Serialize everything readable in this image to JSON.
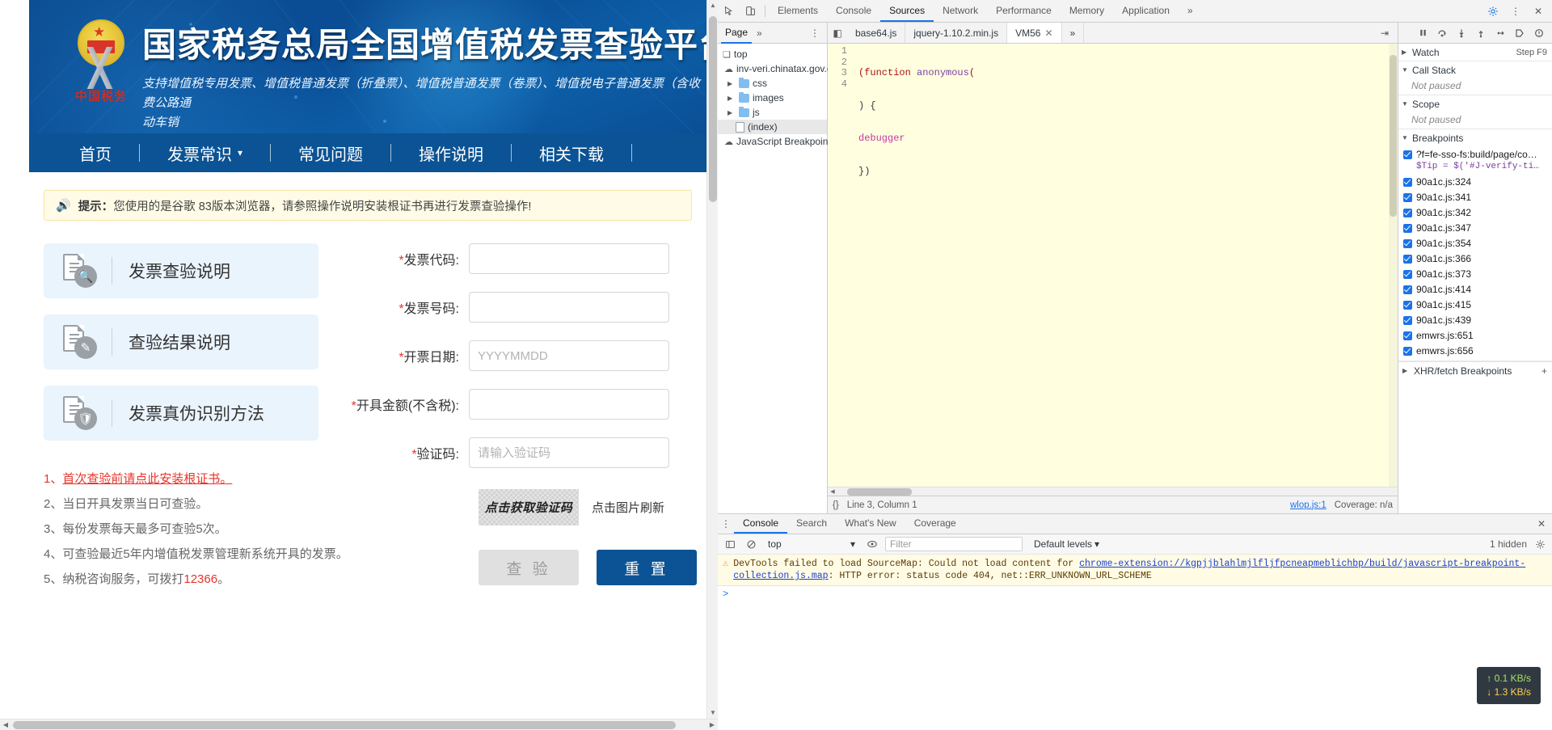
{
  "page": {
    "banner": {
      "title": "国家税务总局全国增值税发票查验平台",
      "subtitle": "支持增值税专用发票、增值税普通发票（折叠票）、增值税普通发票（卷票）、增值税电子普通发票（含收费公路通行费电子普通发票）、机动车销售统一发票、二手车销售统一发票的查验。",
      "subtitle_line1": "支持增值税专用发票、增值税普通发票（折叠票）、增值税普通发票（卷票）、增值税电子普通发票（含收费公路通",
      "subtitle_line2": "动车销",
      "emblem_text": "中国税务"
    },
    "nav": [
      {
        "label": "首页",
        "caret": false
      },
      {
        "label": "发票常识",
        "caret": true
      },
      {
        "label": "常见问题",
        "caret": false
      },
      {
        "label": "操作说明",
        "caret": false
      },
      {
        "label": "相关下载",
        "caret": false
      }
    ],
    "tip": {
      "icon": "speaker-icon",
      "prefix": "提示：",
      "text": "您使用的是谷歌 83版本浏览器，请参照操作说明安装根证书再进行发票查验操作!"
    },
    "cards": [
      {
        "label": "发票查验说明",
        "icon": "document-search-icon"
      },
      {
        "label": "查验结果说明",
        "icon": "document-edit-icon"
      },
      {
        "label": "发票真伪识别方法",
        "icon": "document-shield-icon"
      }
    ],
    "notes": [
      {
        "num": "1、",
        "text": "首次查验前请点此安装根证书。",
        "link": true
      },
      {
        "num": "2、",
        "text": "当日开具发票当日可查验。",
        "link": false
      },
      {
        "num": "3、",
        "text": "每份发票每天最多可查验5次。",
        "link": false
      },
      {
        "num": "4、",
        "text": "可查验最近5年内增值税发票管理新系统开具的发票。",
        "link": false
      },
      {
        "num": "5、",
        "text": "纳税咨询服务，可拨打",
        "suffix": "。",
        "highlight": "12366",
        "link": false
      }
    ],
    "form": {
      "fields": [
        {
          "label": "发票代码:",
          "required": true,
          "value": "",
          "placeholder": ""
        },
        {
          "label": "发票号码:",
          "required": true,
          "value": "",
          "placeholder": ""
        },
        {
          "label": "开票日期:",
          "required": true,
          "value": "",
          "placeholder": "YYYYMMDD"
        },
        {
          "label": "开具金额(不含税):",
          "required": true,
          "value": "",
          "placeholder": ""
        },
        {
          "label": "验证码:",
          "required": true,
          "value": "",
          "placeholder": "请输入验证码"
        }
      ],
      "captcha_text": "点击获取验证码",
      "captcha_hint": "点击图片刷新",
      "submit_label": "查 验",
      "reset_label": "重 置"
    }
  },
  "devtools": {
    "toolbar": {
      "inspect_icon": "cursor-select-icon",
      "device_icon": "device-toggle-icon",
      "tabs": [
        {
          "label": "Elements",
          "active": false
        },
        {
          "label": "Console",
          "active": false
        },
        {
          "label": "Sources",
          "active": true
        },
        {
          "label": "Network",
          "active": false
        },
        {
          "label": "Performance",
          "active": false
        },
        {
          "label": "Memory",
          "active": false
        },
        {
          "label": "Application",
          "active": false
        }
      ],
      "overflow": "»",
      "settings_icon": "gear-icon",
      "kebab_icon": "more-vertical-icon",
      "close_icon": "close-icon"
    },
    "navigator": {
      "tab": "Page",
      "overflow": "»",
      "menu_icon": "more-vertical-icon",
      "tree": [
        {
          "label": "top",
          "icon": "frame-icon",
          "depth": 0,
          "arrow": "",
          "selected": false
        },
        {
          "label": "inv-veri.chinatax.gov.cn",
          "icon": "cloud-icon",
          "depth": 1,
          "arrow": "",
          "selected": false
        },
        {
          "label": "css",
          "icon": "folder-icon",
          "depth": 2,
          "arrow": "▶",
          "selected": false
        },
        {
          "label": "images",
          "icon": "folder-icon",
          "depth": 2,
          "arrow": "▶",
          "selected": false
        },
        {
          "label": "js",
          "icon": "folder-icon",
          "depth": 2,
          "arrow": "▶",
          "selected": false
        },
        {
          "label": "(index)",
          "icon": "file-icon",
          "depth": 2,
          "arrow": "",
          "selected": true
        },
        {
          "label": "JavaScript Breakpoint C",
          "icon": "cloud-icon",
          "depth": 1,
          "arrow": "",
          "selected": false
        }
      ]
    },
    "editor": {
      "tabs": [
        {
          "label": "base64.js",
          "active": false,
          "closeable": false
        },
        {
          "label": "jquery-1.10.2.min.js",
          "active": false,
          "closeable": false
        },
        {
          "label": "VM56",
          "active": true,
          "closeable": true
        }
      ],
      "overflow": "»",
      "code_lines": [
        {
          "n": "1",
          "text": "(function anonymous("
        },
        {
          "n": "2",
          "text": ") {"
        },
        {
          "n": "3",
          "text": "debugger"
        },
        {
          "n": "4",
          "text": "})"
        }
      ],
      "status": {
        "format_icon": "{}",
        "position": "Line 3, Column 1",
        "source": "wlop.js:1",
        "coverage": "Coverage: n/a"
      }
    },
    "debugger": {
      "controls": [
        "pause-icon",
        "step-over-icon",
        "step-into-icon",
        "step-out-icon",
        "step-icon",
        "deactivate-breakpoints-icon",
        "pause-on-exceptions-icon"
      ],
      "sections": [
        {
          "title": "Watch",
          "arrow": "▶",
          "body": "",
          "step_hint": "Step F9"
        },
        {
          "title": "Call Stack",
          "arrow": "▼",
          "body": "Not paused",
          "step_hint": ""
        },
        {
          "title": "Scope",
          "arrow": "▼",
          "body": "Not paused",
          "step_hint": ""
        },
        {
          "title": "Breakpoints",
          "arrow": "▼",
          "body": "",
          "step_hint": ""
        }
      ],
      "breakpoints": [
        {
          "label": "?f=fe-sso-fs:build/page/co…",
          "sub": "$Tip = $('#J-verify-ti…",
          "checked": true
        },
        {
          "label": "90a1c.js:324",
          "sub": "",
          "checked": true
        },
        {
          "label": "90a1c.js:341",
          "sub": "",
          "checked": true
        },
        {
          "label": "90a1c.js:342",
          "sub": "",
          "checked": true
        },
        {
          "label": "90a1c.js:347",
          "sub": "",
          "checked": true
        },
        {
          "label": "90a1c.js:354",
          "sub": "",
          "checked": true
        },
        {
          "label": "90a1c.js:366",
          "sub": "",
          "checked": true
        },
        {
          "label": "90a1c.js:373",
          "sub": "",
          "checked": true
        },
        {
          "label": "90a1c.js:414",
          "sub": "",
          "checked": true
        },
        {
          "label": "90a1c.js:415",
          "sub": "",
          "checked": true
        },
        {
          "label": "90a1c.js:439",
          "sub": "",
          "checked": true
        },
        {
          "label": "emwrs.js:651",
          "sub": "",
          "checked": true
        },
        {
          "label": "emwrs.js:656",
          "sub": "",
          "checked": true
        }
      ],
      "xhr_section": {
        "title": "XHR/fetch Breakpoints",
        "arrow": "▶",
        "plus": "+"
      }
    },
    "drawer": {
      "tabs": [
        {
          "label": "Console",
          "active": true
        },
        {
          "label": "Search",
          "active": false
        },
        {
          "label": "What's New",
          "active": false
        },
        {
          "label": "Coverage",
          "active": false
        }
      ],
      "kebab_icon": "more-vertical-icon",
      "close_icon": "close-icon",
      "toolbar": {
        "sidebar_icon": "show-console-sidebar-icon",
        "clear_icon": "clear-console-icon",
        "context": "top",
        "eye_icon": "live-expression-icon",
        "filter_placeholder": "Filter",
        "levels_label": "Default levels",
        "hidden_label": "1 hidden",
        "settings_icon": "gear-icon"
      },
      "messages": [
        {
          "level": "warning",
          "icon": "warning-triangle-icon",
          "text_before": "DevTools failed to load SourceMap: Could not load content for ",
          "link": "chrome-extension://kgpjjblahlmjlfljfpcneapmeblichbp/build/javascript-breakpoint-collection.js.map",
          "text_after": ": HTTP error: status code 404, net::ERR_UNKNOWN_URL_SCHEME"
        }
      ],
      "prompt": ">"
    },
    "network_indicator": {
      "up": "↑ 0.1 KB/s",
      "down": "↓ 1.3 KB/s"
    }
  },
  "colors": {
    "brand_blue": "#0b5394",
    "accent_blue": "#1a73e8",
    "red": "#e8332a",
    "tip_bg": "#fffbe6"
  }
}
